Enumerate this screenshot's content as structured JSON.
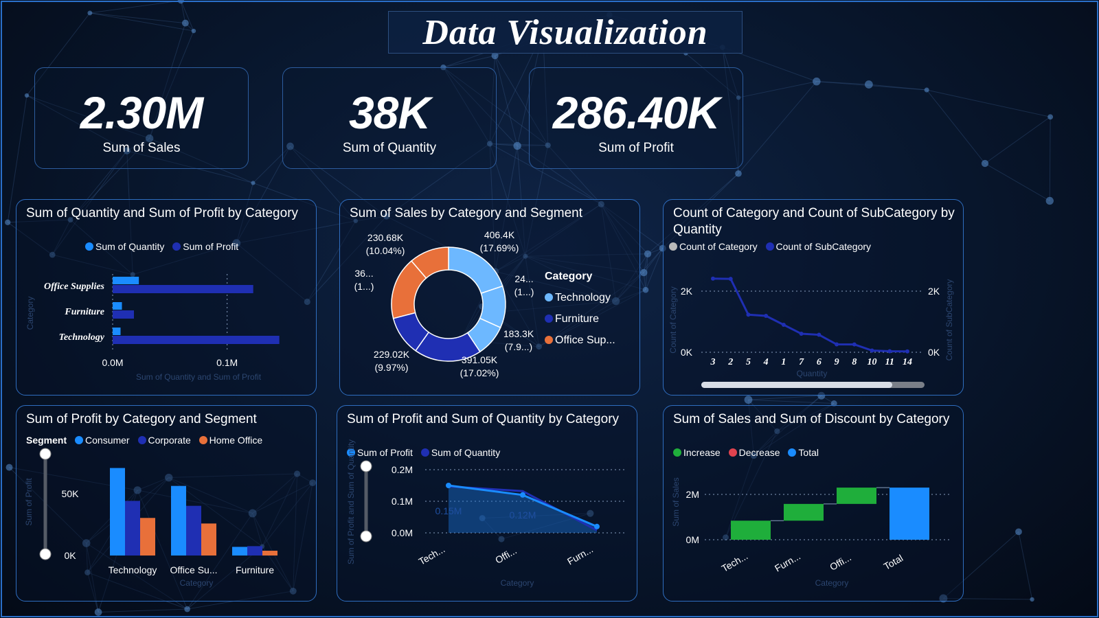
{
  "title": "Data Visualization",
  "colors": {
    "consumer": "#1a8cff",
    "corporate": "#1f2fb3",
    "home_office": "#e8703a",
    "light_blue": "#6db8ff",
    "increase": "#1fae3b",
    "decrease": "#e0434f",
    "total": "#1a8cff",
    "gray": "#b9b9b9"
  },
  "kpis": [
    {
      "value": "2.30M",
      "label": "Sum of Sales"
    },
    {
      "value": "38K",
      "label": "Sum of Quantity"
    },
    {
      "value": "286.40K",
      "label": "Sum of Profit"
    }
  ],
  "panels": {
    "qty_profit_bar": {
      "title": "Sum of Quantity and Sum of Profit by Category",
      "legend": [
        "Sum of Quantity",
        "Sum of Profit"
      ],
      "ylabel": "Category",
      "xlabel": "Sum of Quantity and Sum of Profit",
      "ticks": [
        "0.0M",
        "0.1M"
      ]
    },
    "sales_donut": {
      "title": "Sum of Sales by Category and Segment",
      "legend_title": "Category",
      "legend": [
        "Technology",
        "Furniture",
        "Office Sup..."
      ],
      "labels": [
        {
          "line1": "406.4K",
          "line2": "(17.69%)"
        },
        {
          "line1": "24...",
          "line2": "(1...)"
        },
        {
          "line1": "183.3K",
          "line2": "(7.9...)"
        },
        {
          "line1": "391.05K",
          "line2": "(17.02%)"
        },
        {
          "line1": "229.02K",
          "line2": "(9.97%)"
        },
        {
          "line1": "36...",
          "line2": "(1...)"
        },
        {
          "line1": "230.68K",
          "line2": "(10.04%)"
        }
      ]
    },
    "count_line": {
      "title": "Count of Category and Count of SubCategory by Quantity",
      "legend": [
        "Count of Category",
        "Count of SubCategory"
      ],
      "y_left_label": "Count of Category",
      "y_right_label": "Count of SubCategory",
      "xlabel": "Quantity",
      "y_ticks": [
        "2K",
        "0K"
      ]
    },
    "profit_seg": {
      "title": "Sum of Profit by Category and Segment",
      "legend_title": "Segment",
      "legend": [
        "Consumer",
        "Corporate",
        "Home Office"
      ],
      "ylabel": "Sum of Profit",
      "xlabel": "Category",
      "y_ticks": [
        "50K",
        "0K"
      ]
    },
    "profit_qty_area": {
      "title": "Sum of Profit and Sum of Quantity by Category",
      "legend": [
        "Sum of Profit",
        "Sum of Quantity"
      ],
      "ylabel": "Sum of Profit and Sum of Quantity",
      "xlabel": "Category",
      "y_ticks": [
        "0.2M",
        "0.1M",
        "0.0M"
      ],
      "point_labels": [
        "0.15M",
        "0.12M"
      ]
    },
    "waterfall": {
      "title": "Sum of Sales and Sum of Discount by Category",
      "legend": [
        "Increase",
        "Decrease",
        "Total"
      ],
      "ylabel": "Sum of Sales",
      "xlabel": "Category",
      "y_ticks": [
        "2M",
        "0M"
      ]
    }
  },
  "chart_data": [
    {
      "type": "bar",
      "title": "Sum of Quantity and Sum of Profit by Category",
      "orientation": "horizontal",
      "categories": [
        "Office Supplies",
        "Furniture",
        "Technology"
      ],
      "series": [
        {
          "name": "Sum of Quantity",
          "values": [
            0.0229,
            0.0081,
            0.0069
          ]
        },
        {
          "name": "Sum of Profit",
          "values": [
            0.1228,
            0.0186,
            0.1456
          ]
        }
      ],
      "xlim": [
        0,
        0.15
      ],
      "xticks": [
        "0.0M",
        "0.1M"
      ],
      "xlabel": "Sum of Quantity and Sum of Profit",
      "ylabel": "Category"
    },
    {
      "type": "pie",
      "title": "Sum of Sales by Category and Segment",
      "legend_title": "Category",
      "slices": [
        {
          "label": "406.4K",
          "category": "Technology",
          "value": 406.4
        },
        {
          "label": "24...",
          "category": "Technology",
          "value": 243.2
        },
        {
          "label": "183.3K",
          "category": "Technology",
          "value": 183.3
        },
        {
          "label": "391.05K",
          "category": "Furniture",
          "value": 391.05
        },
        {
          "label": "229.02K",
          "category": "Furniture",
          "value": 229.02
        },
        {
          "label": "36...",
          "category": "Office Sup...",
          "value": 363.0
        },
        {
          "label": "230.68K",
          "category": "Office Sup...",
          "value": 230.68
        }
      ]
    },
    {
      "type": "line",
      "title": "Count of Category and Count of SubCategory by Quantity",
      "categories": [
        "3",
        "2",
        "5",
        "4",
        "1",
        "7",
        "6",
        "9",
        "8",
        "10",
        "11",
        "14"
      ],
      "series": [
        {
          "name": "Count of Category",
          "values": [
            2409,
            2402,
            1230,
            1191,
            899,
            606,
            572,
            258,
            257,
            57,
            34,
            29
          ]
        },
        {
          "name": "Count of SubCategory",
          "values": [
            2409,
            2402,
            1230,
            1191,
            899,
            606,
            572,
            258,
            257,
            57,
            34,
            29
          ]
        }
      ],
      "yticks": [
        "2K",
        "0K"
      ],
      "xlabel": "Quantity",
      "ylabel": "Count of Category",
      "y2label": "Count of SubCategory"
    },
    {
      "type": "bar",
      "title": "Sum of Profit by Category and Segment",
      "categories": [
        "Technology",
        "Office Su...",
        "Furniture"
      ],
      "series": [
        {
          "name": "Consumer",
          "values": [
            70800,
            56300,
            6990
          ]
        },
        {
          "name": "Corporate",
          "values": [
            44200,
            40200,
            7580
          ]
        },
        {
          "name": "Home Office",
          "values": [
            30400,
            25900,
            3880
          ]
        }
      ],
      "ylim": [
        0,
        75000
      ],
      "yticks": [
        "50K",
        "0K"
      ],
      "xlabel": "Category",
      "ylabel": "Sum of Profit"
    },
    {
      "type": "area",
      "title": "Sum of Profit and Sum of Quantity by Category",
      "categories": [
        "Tech...",
        "Offi...",
        "Furn..."
      ],
      "series": [
        {
          "name": "Sum of Profit",
          "values": [
            0.15,
            0.12,
            0.02
          ]
        },
        {
          "name": "Sum of Quantity",
          "values": [
            0.147,
            0.132,
            0.008
          ]
        }
      ],
      "ylim": [
        0,
        0.2
      ],
      "yticks": [
        "0.2M",
        "0.1M",
        "0.0M"
      ],
      "xlabel": "Category",
      "ylabel": "Sum of Profit and Sum of Quantity"
    },
    {
      "type": "bar",
      "subtype": "waterfall",
      "title": "Sum of Sales and Sum of Discount by Category",
      "categories": [
        "Tech...",
        "Furn...",
        "Offi...",
        "Total"
      ],
      "values": [
        0.84,
        0.74,
        0.72,
        2.3
      ],
      "kinds": [
        "Increase",
        "Increase",
        "Increase",
        "Total"
      ],
      "yticks": [
        "2M",
        "0M"
      ],
      "xlabel": "Category",
      "ylabel": "Sum of Sales"
    }
  ]
}
